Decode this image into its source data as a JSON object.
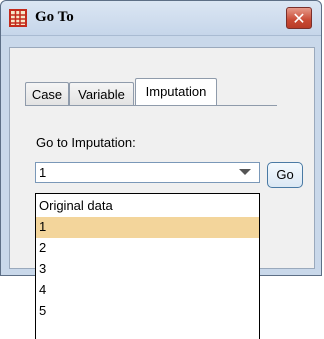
{
  "window": {
    "title": "Go To",
    "close_icon": "close-icon",
    "app_icon": "spreadsheet-grid-icon",
    "colors": {
      "title_bar": "#c6d6ea",
      "close_button": "#c94a35",
      "selection": "#f3d59b"
    }
  },
  "tabs": [
    {
      "label": "Case",
      "active": false
    },
    {
      "label": "Variable",
      "active": false
    },
    {
      "label": "Imputation",
      "active": true
    }
  ],
  "form": {
    "go_to_label": "Go to Imputation:",
    "combo_value": "1",
    "go_button_label": "Go"
  },
  "dropdown": {
    "options": [
      "Original data",
      "1",
      "2",
      "3",
      "4",
      "5"
    ],
    "selected": "1"
  }
}
